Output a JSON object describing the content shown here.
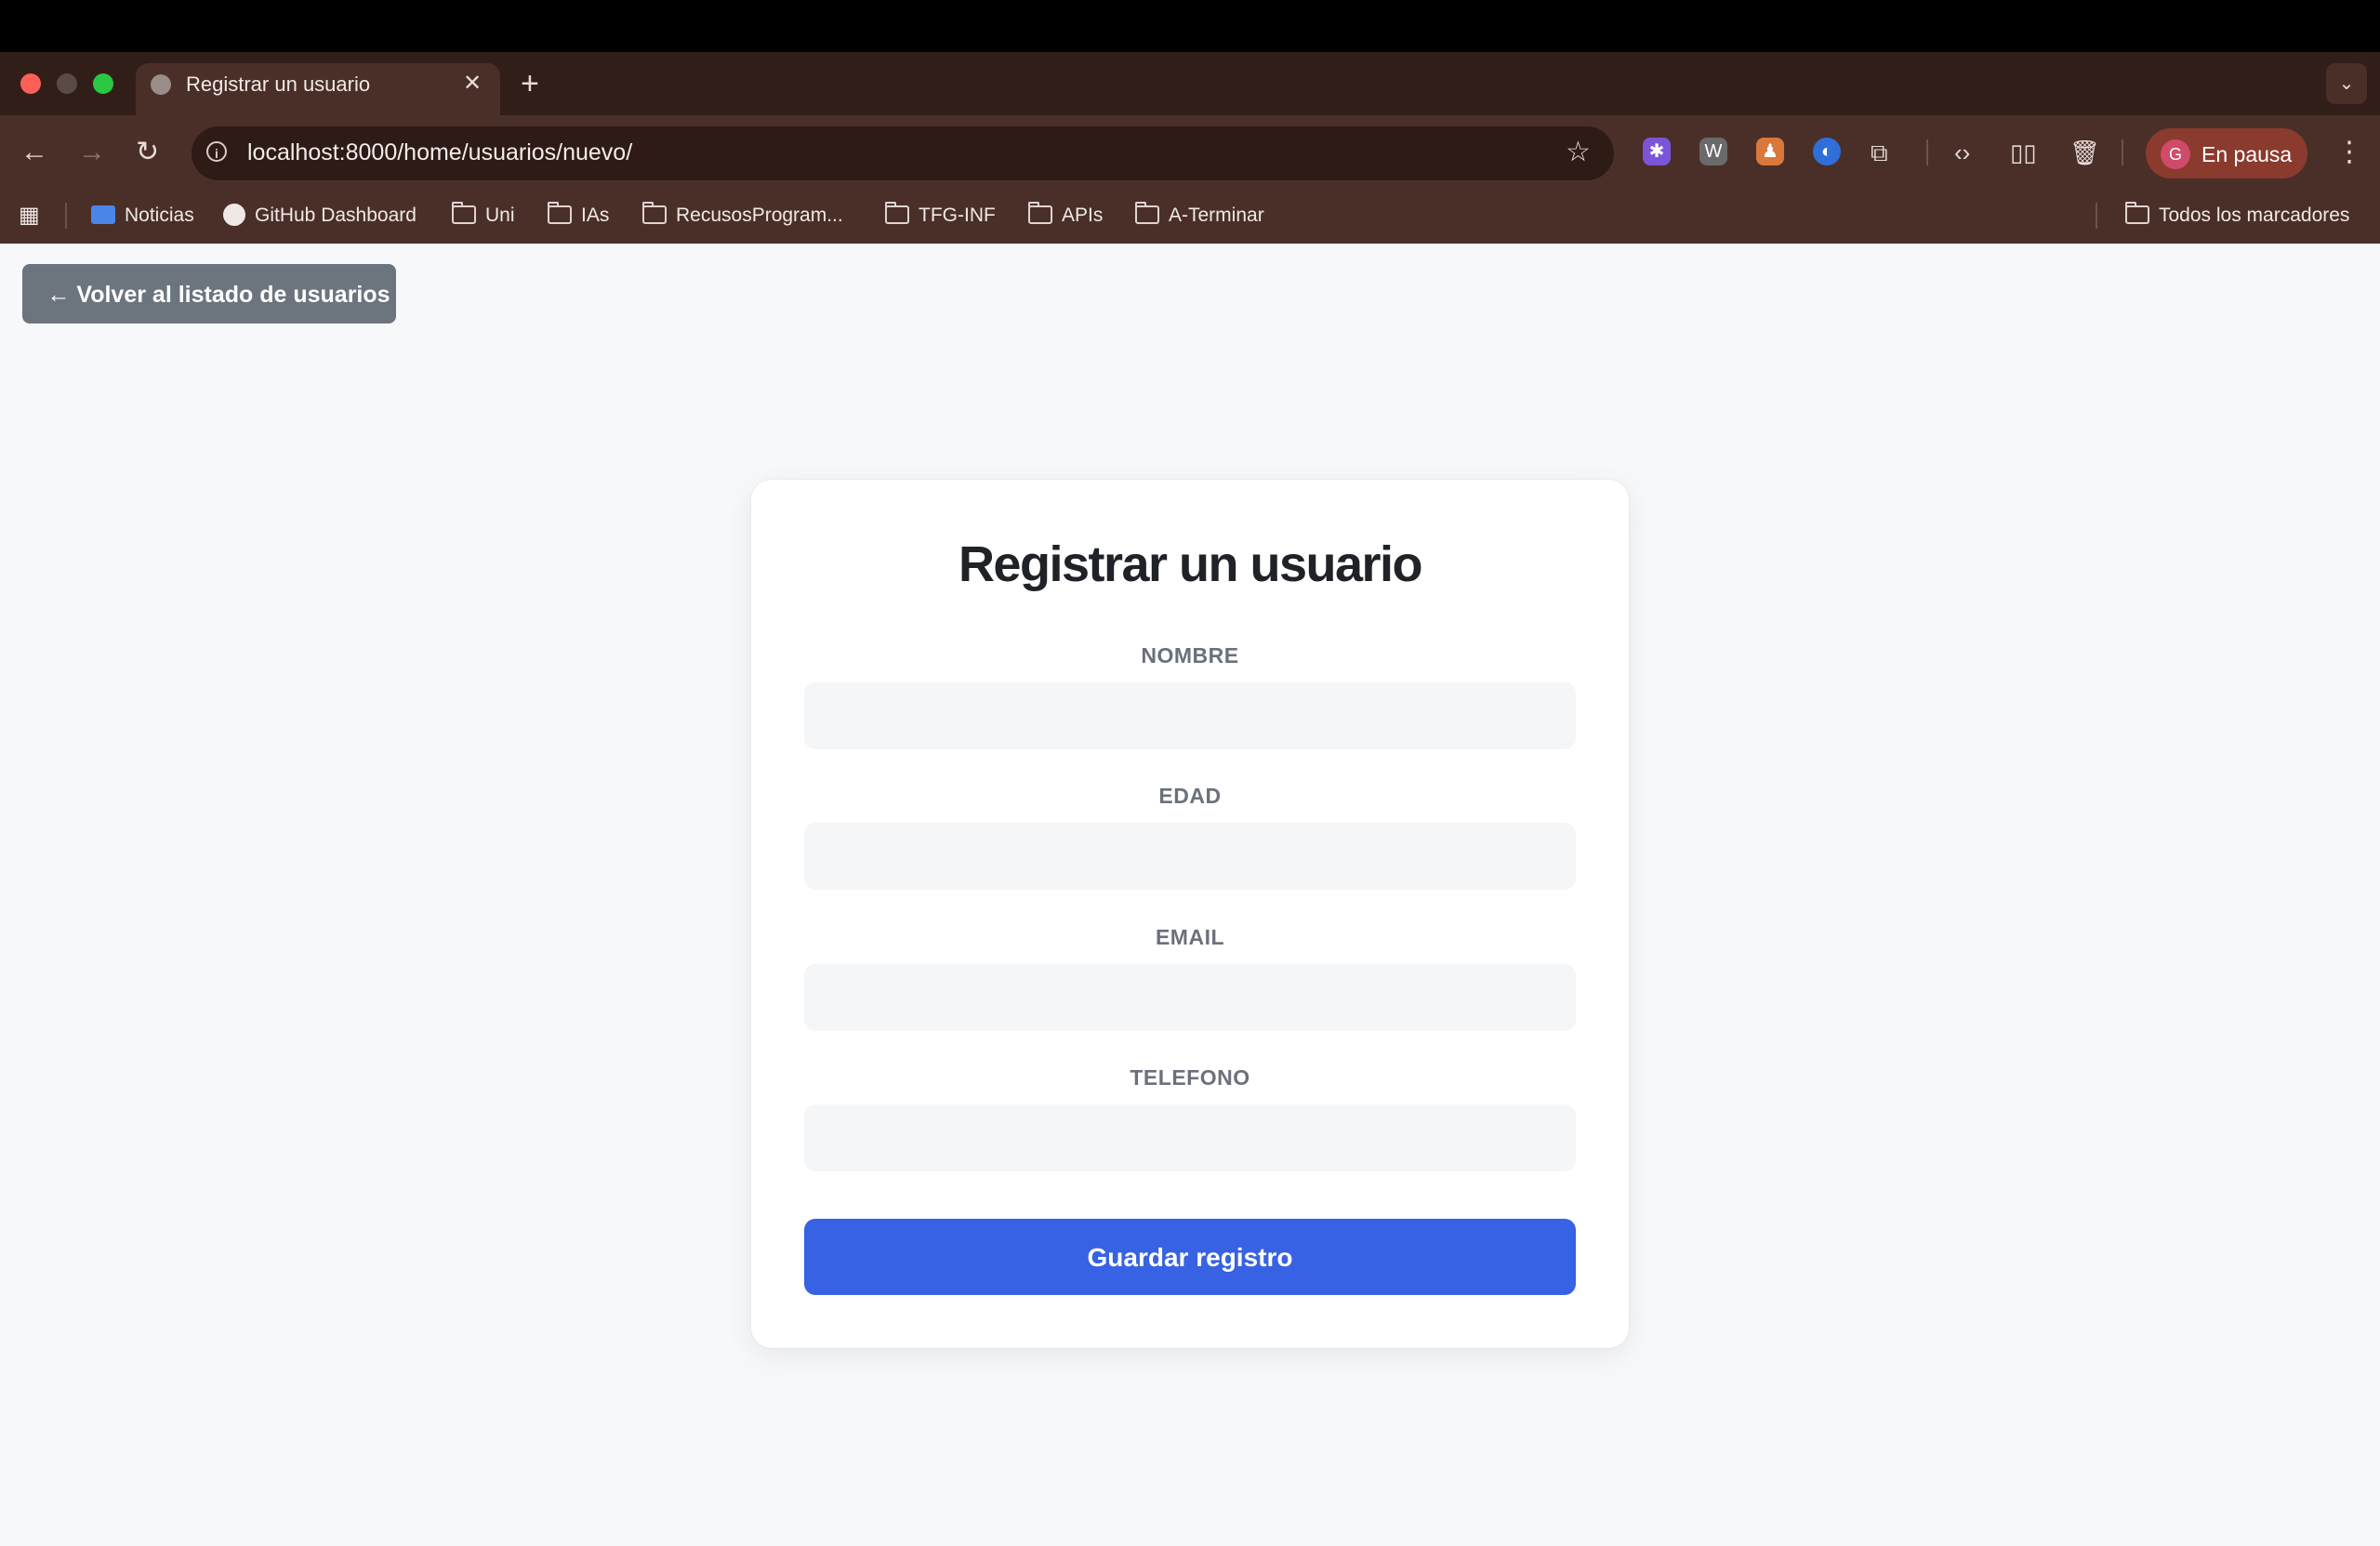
{
  "browser": {
    "tab": {
      "title": "Registrar un usuario",
      "close": "✕"
    },
    "new_tab": "+",
    "tab_menu": "⌄",
    "nav": {
      "back": "←",
      "forward": "→",
      "reload": "↻"
    },
    "url": "localhost:8000/home/usuarios/nuevo/",
    "star": "☆",
    "profile": {
      "initial": "G",
      "label": "En pausa"
    },
    "menu": "⋮",
    "bookmarks": [
      {
        "label": "Noticias",
        "icon": "google-news-icon"
      },
      {
        "label": "GitHub Dashboard",
        "icon": "github-icon"
      },
      {
        "label": "Uni",
        "icon": "folder-icon"
      },
      {
        "label": "IAs",
        "icon": "folder-icon"
      },
      {
        "label": "RecusosProgram...",
        "icon": "folder-icon"
      },
      {
        "label": "TFG-INF",
        "icon": "folder-icon"
      },
      {
        "label": "APIs",
        "icon": "folder-icon"
      },
      {
        "label": "A-Terminar",
        "icon": "folder-icon"
      }
    ],
    "all_bookmarks": "Todos los marcadores",
    "colors": {
      "frame": "#321e19",
      "toolbar": "#4a2f28",
      "omnibox": "#2e1b16"
    }
  },
  "page": {
    "back_button": "← Volver al listado de usuarios",
    "title": "Registrar un usuario",
    "fields": [
      {
        "label": "NOMBRE",
        "value": ""
      },
      {
        "label": "EDAD",
        "value": ""
      },
      {
        "label": "EMAIL",
        "value": ""
      },
      {
        "label": "TELEFONO",
        "value": ""
      }
    ],
    "submit": "Guardar registro",
    "colors": {
      "primary": "#3762e4",
      "secondary": "#6c747e",
      "background": "#f7f8fa"
    }
  }
}
